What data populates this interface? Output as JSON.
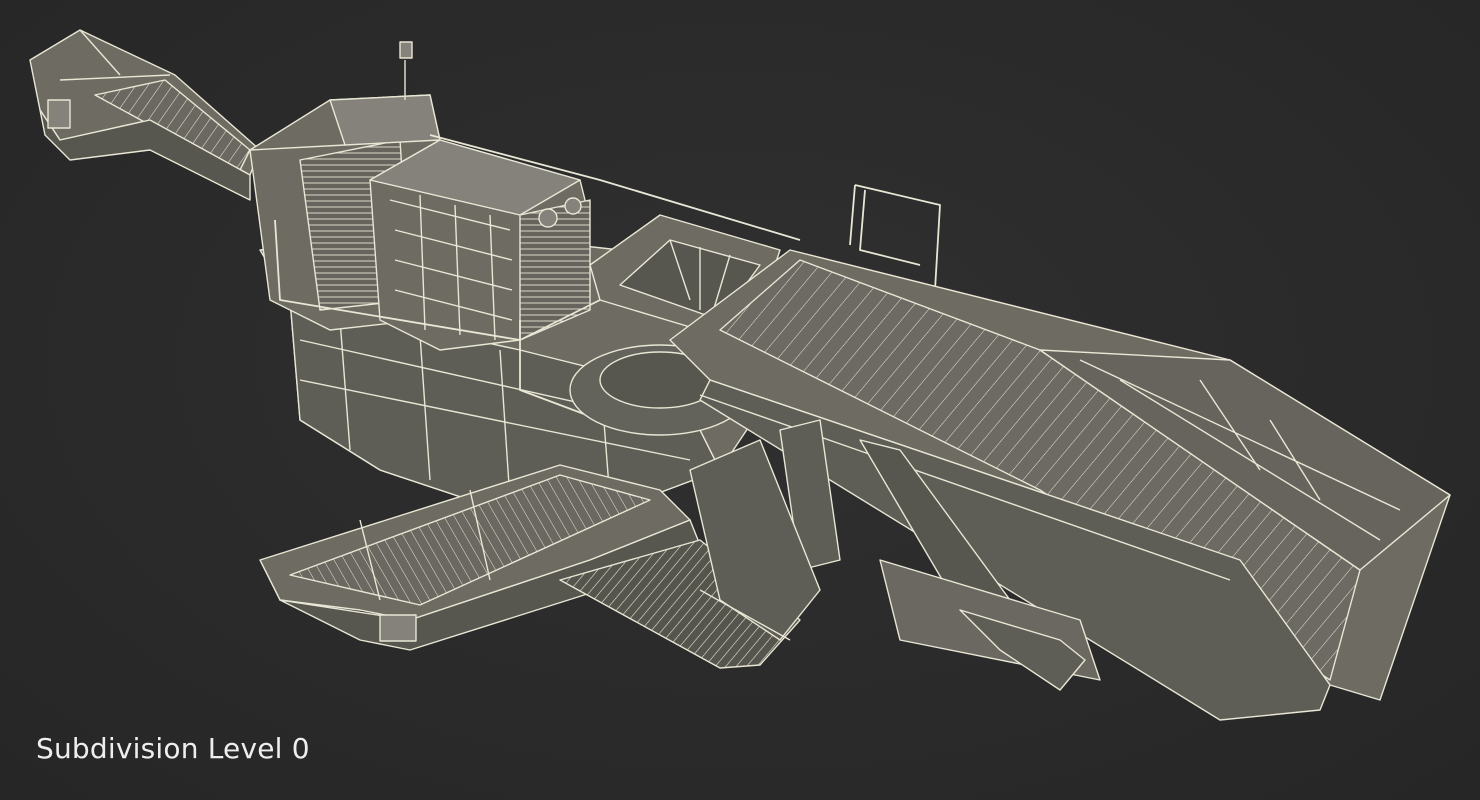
{
  "scene": {
    "subject": "mobile crusher machine wireframe render",
    "caption": "Subdivision Level 0",
    "colors": {
      "background": "#2b2b2b",
      "body": "#6e6c62",
      "body_dark": "#57564f",
      "body_light": "#84827a",
      "wire": "#e8e6d4",
      "caption_text": "#eeeeee"
    }
  }
}
